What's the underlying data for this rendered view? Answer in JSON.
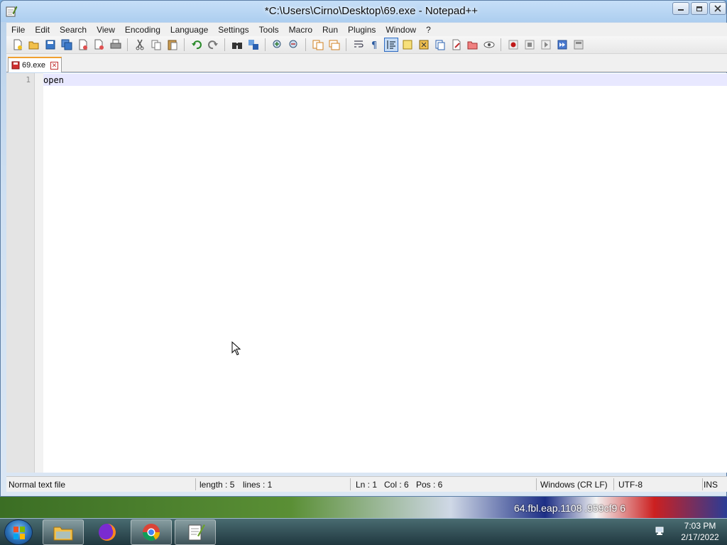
{
  "window": {
    "title": "*C:\\Users\\Cirno\\Desktop\\69.exe - Notepad++"
  },
  "menu": [
    {
      "label": "File"
    },
    {
      "label": "Edit"
    },
    {
      "label": "Search"
    },
    {
      "label": "View"
    },
    {
      "label": "Encoding"
    },
    {
      "label": "Language"
    },
    {
      "label": "Settings"
    },
    {
      "label": "Tools"
    },
    {
      "label": "Macro"
    },
    {
      "label": "Run"
    },
    {
      "label": "Plugins"
    },
    {
      "label": "Window"
    },
    {
      "label": "?"
    }
  ],
  "tab": {
    "label": "69.exe"
  },
  "editor": {
    "line_number": "1",
    "line_text": "open"
  },
  "status": {
    "file_type": "Normal text file",
    "length": "length : 5",
    "lines": "lines : 1",
    "ln": "Ln : 1",
    "col": "Col : 6",
    "pos": "Pos : 6",
    "eol": "Windows (CR LF)",
    "encoding": "UTF-8",
    "mode": "INS"
  },
  "desktop": {
    "wallpaper_text": "64.fbl.eap.1108 .959cf9 6"
  },
  "taskbar": {
    "time": "7:03 PM",
    "date": "2/17/2022"
  },
  "colors": {
    "current_line": "#e8e8ff",
    "tab_accent": "#f0a030",
    "active_toolbar": "#c6dcf5"
  }
}
